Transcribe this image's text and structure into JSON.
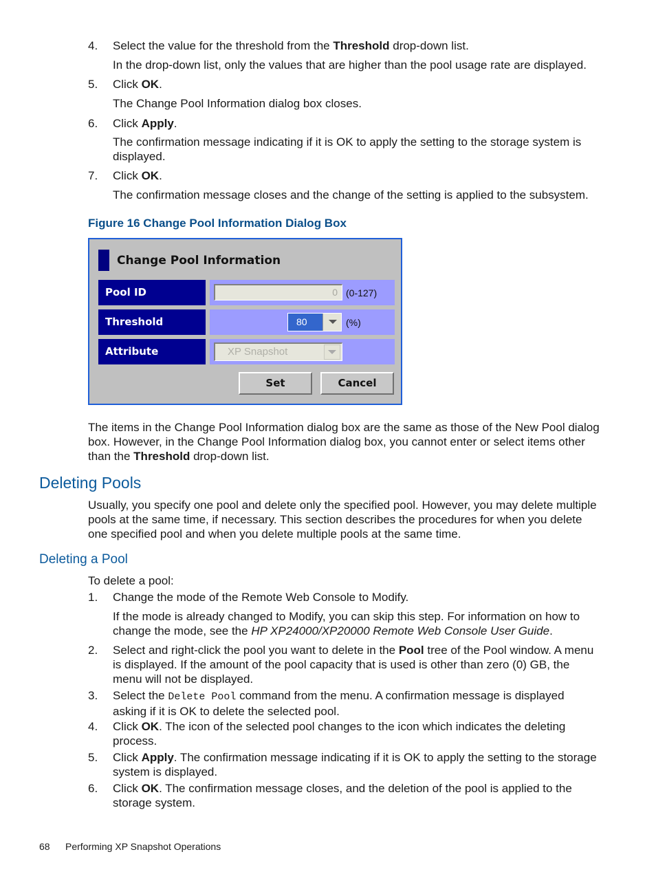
{
  "top_steps": [
    {
      "num": "4.",
      "pre": "Select the value for the threshold from the ",
      "bold": "Threshold",
      "post": " drop-down list.",
      "note": "In the drop-down list, only the values that are higher than the pool usage rate are displayed."
    },
    {
      "num": "5.",
      "pre": "Click ",
      "bold": "OK",
      "post": ".",
      "note": "The Change Pool Information dialog box closes."
    },
    {
      "num": "6.",
      "pre": "Click ",
      "bold": "Apply",
      "post": ".",
      "note": "The confirmation message indicating if it is OK to apply the setting to the storage system is displayed."
    },
    {
      "num": "7.",
      "pre": "Click ",
      "bold": "OK",
      "post": ".",
      "note": "The confirmation message closes and the change of the setting is applied to the subsystem."
    }
  ],
  "figure": {
    "caption": "Figure 16 Change Pool Information Dialog Box",
    "dialog": {
      "title": "Change Pool Information",
      "pool_id": {
        "label": "Pool ID",
        "value": "0",
        "range": "(0-127)"
      },
      "threshold": {
        "label": "Threshold",
        "value": "80",
        "unit": "(%)"
      },
      "attribute": {
        "label": "Attribute",
        "value": "XP Snapshot"
      },
      "buttons": {
        "set": "Set",
        "cancel": "Cancel"
      }
    }
  },
  "after_figure": {
    "pre": "The items in the Change Pool Information dialog box are the same as those of the New Pool dialog box. However, in the Change Pool Information dialog box, you cannot enter or select items other than the ",
    "bold": "Threshold",
    "post": " drop-down list."
  },
  "section": {
    "title": "Deleting Pools",
    "intro": "Usually, you specify one pool and delete only the specified pool. However, you may delete multiple pools at the same time, if necessary. This section describes the procedures for when you delete one specified pool and when you delete multiple pools at the same time."
  },
  "subsection": {
    "title": "Deleting a Pool",
    "lead": "To delete a pool:",
    "steps": [
      {
        "num": "1.",
        "text": "Change the mode of the Remote Web Console to Modify.",
        "note_pre": "If the mode is already changed to Modify, you can skip this step. For information on how to change the mode, see the ",
        "note_italic": "HP XP24000/XP20000 Remote Web Console User Guide",
        "note_post": "."
      },
      {
        "num": "2.",
        "pre": "Select and right-click the pool you want to delete in the ",
        "bold": "Pool",
        "post": " tree of the Pool window. A menu is displayed. If the amount of the pool capacity that is used is other than zero (0) GB, the menu will not be displayed."
      },
      {
        "num": "3.",
        "pre": "Select the ",
        "mono": "Delete Pool",
        "post": " command from the menu. A confirmation message is displayed asking if it is OK to delete the selected pool."
      },
      {
        "num": "4.",
        "pre": "Click ",
        "bold": "OK",
        "post": ". The icon of the selected pool changes to the icon which indicates the deleting process."
      },
      {
        "num": "5.",
        "pre": "Click ",
        "bold": "Apply",
        "post": ". The confirmation message indicating if it is OK to apply the setting to the storage system is displayed."
      },
      {
        "num": "6.",
        "pre": "Click ",
        "bold": "OK",
        "post": ". The confirmation message closes, and the deletion of the pool is applied to the storage system."
      }
    ]
  },
  "footer": {
    "page": "68",
    "title": "Performing XP Snapshot Operations"
  }
}
